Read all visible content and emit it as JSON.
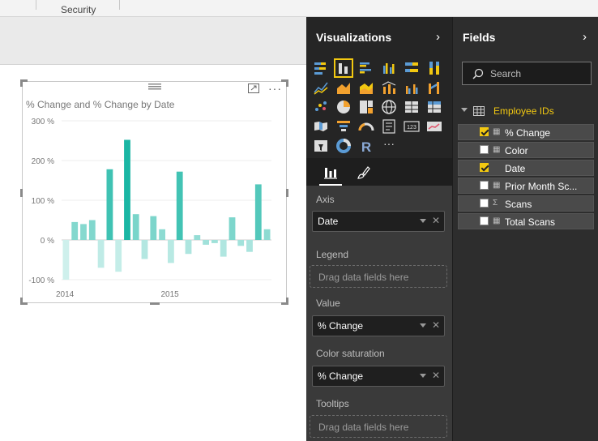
{
  "ribbon": {
    "group_label": "Security"
  },
  "visual": {
    "title": "% Change and % Change by Date",
    "more_label": "···",
    "chart_data": {
      "type": "bar",
      "title": "% Change and % Change by Date",
      "y_ticks": [
        "300 %",
        "200 %",
        "100 %",
        "0 %",
        "-100 %"
      ],
      "x_ticks": [
        "2014",
        "2015"
      ],
      "ylim": [
        -100,
        300
      ],
      "grid": true,
      "series": [
        {
          "name": "% Change",
          "color": "#1ebfae",
          "values": [
            -100,
            45,
            40,
            50,
            -70,
            178,
            -80,
            252,
            65,
            -48,
            60,
            27,
            -58,
            172,
            -35,
            12,
            -12,
            -8,
            -42,
            57,
            -15,
            -30,
            140,
            27
          ]
        }
      ]
    }
  },
  "visualizations": {
    "title": "Visualizations",
    "collapse_icon": "chevron-right-icon",
    "tabs": [
      "fields-tab-icon",
      "format-paintbrush-icon"
    ],
    "more_label": "···",
    "wells": {
      "axis_label": "Axis",
      "axis_value": "Date",
      "legend_label": "Legend",
      "drop_placeholder": "Drag data fields here",
      "value_label": "Value",
      "value_value": "% Change",
      "color_label": "Color saturation",
      "color_value": "% Change",
      "tooltips_label": "Tooltips"
    }
  },
  "fields": {
    "title": "Fields",
    "search_placeholder": "Search",
    "table_name": "Employee IDs",
    "items": [
      {
        "label": "% Change",
        "checked": true,
        "icon": "calculator-icon"
      },
      {
        "label": "Color",
        "checked": false,
        "icon": "calculator-icon"
      },
      {
        "label": "Date",
        "checked": true,
        "icon": "none"
      },
      {
        "label": "Prior Month Sc...",
        "checked": false,
        "icon": "calculator-icon"
      },
      {
        "label": "Scans",
        "checked": false,
        "icon": "sigma-icon"
      },
      {
        "label": "Total Scans",
        "checked": false,
        "icon": "calculator-icon"
      }
    ]
  }
}
